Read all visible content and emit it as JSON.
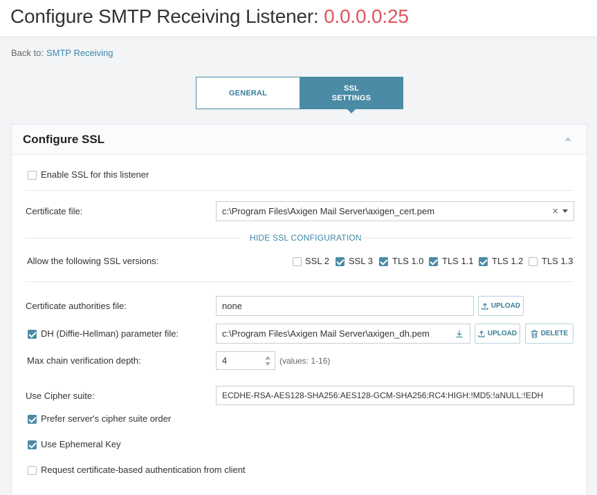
{
  "header": {
    "title": "Configure SMTP Receiving Listener: ",
    "address": "0.0.0.0:25"
  },
  "back": {
    "label": "Back to:",
    "link": "SMTP Receiving"
  },
  "tabs": [
    {
      "label": "General"
    },
    {
      "label": "SSL Settings"
    }
  ],
  "panel": {
    "title": "Configure SSL"
  },
  "enable_ssl": {
    "label": "Enable SSL for this listener",
    "checked": false
  },
  "certificate": {
    "label": "Certificate file:",
    "value": "c:\\Program Files\\Axigen Mail Server\\axigen_cert.pem"
  },
  "hide_ssl_link": "HIDE SSL CONFIGURATION",
  "ssl_versions": {
    "label": "Allow the following SSL versions:",
    "items": [
      {
        "label": "SSL 2",
        "checked": false
      },
      {
        "label": "SSL 3",
        "checked": true
      },
      {
        "label": "TLS 1.0",
        "checked": true
      },
      {
        "label": "TLS 1.1",
        "checked": true
      },
      {
        "label": "TLS 1.2",
        "checked": true
      },
      {
        "label": "TLS 1.3",
        "checked": false
      }
    ]
  },
  "ca_file": {
    "label": "Certificate authorities file:",
    "value": "none",
    "upload": "UPLOAD"
  },
  "dh_file": {
    "label": "DH (Diffie-Hellman) parameter file:",
    "checked": true,
    "value": "c:\\Program Files\\Axigen Mail Server\\axigen_dh.pem",
    "upload": "UPLOAD",
    "delete": "DELETE"
  },
  "chain_depth": {
    "label": "Max chain verification depth:",
    "value": "4",
    "hint": "(values: 1-16)"
  },
  "cipher": {
    "label": "Use Cipher suite:",
    "value": "ECDHE-RSA-AES128-SHA256:AES128-GCM-SHA256:RC4:HIGH:!MD5:!aNULL:!EDH"
  },
  "options": [
    {
      "label": "Prefer server's cipher suite order",
      "checked": true
    },
    {
      "label": "Use Ephemeral Key",
      "checked": true
    },
    {
      "label": "Request certificate-based authentication from client",
      "checked": false
    }
  ]
}
